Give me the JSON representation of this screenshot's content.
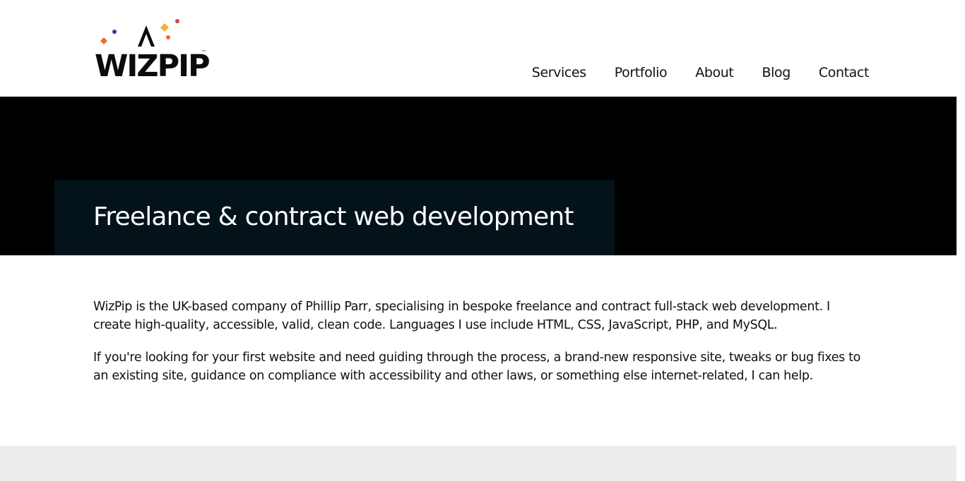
{
  "header": {
    "logo_text": "WIZPIP",
    "logo_mark": "™",
    "nav": [
      {
        "label": "Services"
      },
      {
        "label": "Portfolio"
      },
      {
        "label": "About"
      },
      {
        "label": "Blog"
      },
      {
        "label": "Contact"
      }
    ]
  },
  "hero": {
    "title": "Freelance & contract web development"
  },
  "content": {
    "intro": "WizPip is the UK-based company of Phillip Parr, specialising in bespoke freelance and contract full-stack web development. I create high-quality, accessible, valid, clean code. Languages I use include HTML, CSS, JavaScript, PHP, and MySQL.",
    "help": "If you're looking for your first website and need guiding through the process, a brand-new responsive site, tweaks or bug fixes to an existing site, guidance on compliance with accessibility and other laws, or something else internet-related, I can help."
  },
  "colors": {
    "hero_bg": "#000000",
    "hero_box": "#04131a",
    "footer_band": "#ededed",
    "sparkle_orange": "#f26a2e",
    "sparkle_yellow": "#f2b233",
    "sparkle_blue": "#2c3e94",
    "sparkle_red": "#d9413b"
  }
}
